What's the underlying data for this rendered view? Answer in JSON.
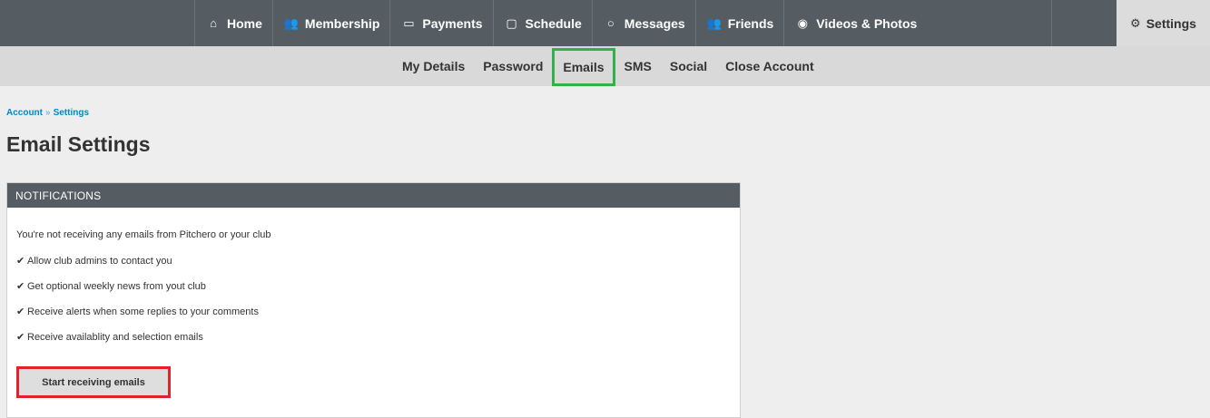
{
  "topnav": {
    "items": [
      {
        "label": "Home",
        "icon": "home-icon",
        "glyph": "⌂"
      },
      {
        "label": "Membership",
        "icon": "members-icon",
        "glyph": "👥"
      },
      {
        "label": "Payments",
        "icon": "card-icon",
        "glyph": "▭"
      },
      {
        "label": "Schedule",
        "icon": "calendar-icon",
        "glyph": "▢"
      },
      {
        "label": "Messages",
        "icon": "message-icon",
        "glyph": "○"
      },
      {
        "label": "Friends",
        "icon": "friends-icon",
        "glyph": "👥"
      },
      {
        "label": "Videos & Photos",
        "icon": "play-icon",
        "glyph": "◉"
      }
    ],
    "settings": {
      "label": "Settings",
      "icon": "gear-icon",
      "glyph": "⚙"
    }
  },
  "subnav": {
    "items": [
      {
        "label": "My Details",
        "active": false
      },
      {
        "label": "Password",
        "active": false
      },
      {
        "label": "Emails",
        "active": true
      },
      {
        "label": "SMS",
        "active": false
      },
      {
        "label": "Social",
        "active": false
      },
      {
        "label": "Close Account",
        "active": false
      }
    ]
  },
  "breadcrumb": {
    "account": "Account",
    "separator": "»",
    "settings": "Settings"
  },
  "page": {
    "title": "Email Settings"
  },
  "panel": {
    "header": "NOTIFICATIONS",
    "intro": "You're not receiving any emails from Pitchero or your club",
    "check_glyph": "✔",
    "features": [
      "Allow club admins to contact you",
      "Get optional weekly news from yout club",
      "Receive alerts when some replies to your comments",
      "Receive availablity and selection emails"
    ],
    "button_label": "Start receiving emails"
  },
  "colors": {
    "nav_bg": "#555d62",
    "subnav_bg": "#d9d9d9",
    "link": "#0089c8",
    "active_outline": "#2db34a",
    "cta_outline": "#e1222a"
  }
}
